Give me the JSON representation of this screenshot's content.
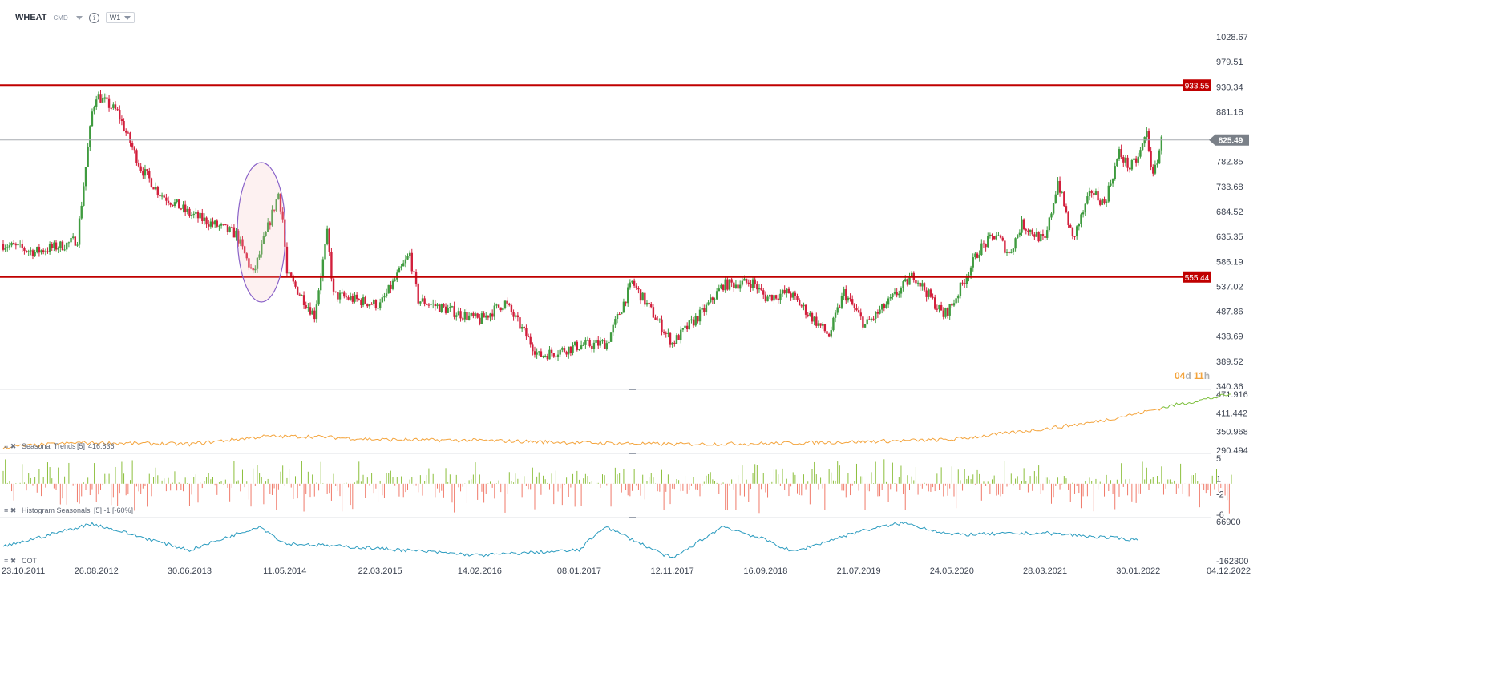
{
  "header": {
    "symbol": "WHEAT",
    "market": "CMD",
    "timeframe": "W1"
  },
  "colors": {
    "up": "#3f9b3f",
    "down": "#d21f3c",
    "level": "#c00000",
    "price_line": "#a7abb0",
    "price_badge": "#7a8088",
    "seasonal_past": "#f4a43c",
    "seasonal_future": "#7cbf3c",
    "hist_pos": "#8cbf3c",
    "hist_neg": "#f07a6a",
    "cot": "#2a9bbf",
    "ellipse": "#8a63c9",
    "countdown": "#f4a43c"
  },
  "chart_data": [
    {
      "type": "candlestick",
      "title": "WHEAT",
      "y_ticks": [
        "1028.67",
        "979.51",
        "930.34",
        "881.18",
        "782.85",
        "733.68",
        "684.52",
        "635.35",
        "586.19",
        "537.02",
        "487.86",
        "438.69",
        "389.52",
        "340.36"
      ],
      "ylim": [
        340.36,
        1028.67
      ],
      "x_ticks": [
        "23.10.2011",
        "26.08.2012",
        "30.06.2013",
        "11.05.2014",
        "22.03.2015",
        "14.02.2016",
        "08.01.2017",
        "12.11.2017",
        "16.09.2018",
        "21.07.2019",
        "24.05.2020",
        "28.03.2021",
        "30.01.2022",
        "04.12.2022"
      ],
      "horizontal_levels": [
        {
          "value": 933.55,
          "label": "933.55"
        },
        {
          "value": 555.44,
          "label": "555.44"
        }
      ],
      "current_price": {
        "value": 825.49,
        "label": "825.49"
      },
      "countdown": {
        "days": "04",
        "d": "d",
        "hours": "11",
        "h": "h"
      },
      "trend_keypoints": [
        {
          "date": "23.10.2011",
          "close": 620
        },
        {
          "date": "05.02.2012",
          "close": 605
        },
        {
          "date": "20.05.2012",
          "close": 620
        },
        {
          "date": "24.06.2012",
          "close": 630
        },
        {
          "date": "12.08.2012",
          "close": 880
        },
        {
          "date": "26.08.2012",
          "close": 915
        },
        {
          "date": "04.11.2012",
          "close": 880
        },
        {
          "date": "20.01.2013",
          "close": 770
        },
        {
          "date": "24.03.2013",
          "close": 720
        },
        {
          "date": "30.06.2013",
          "close": 680
        },
        {
          "date": "01.12.2013",
          "close": 640
        },
        {
          "date": "26.01.2014",
          "close": 560
        },
        {
          "date": "20.04.2014",
          "close": 720
        },
        {
          "date": "04.05.2014",
          "close": 670
        },
        {
          "date": "18.05.2014",
          "close": 560
        },
        {
          "date": "17.08.2014",
          "close": 480
        },
        {
          "date": "28.09.2014",
          "close": 640
        },
        {
          "date": "19.10.2014",
          "close": 520
        },
        {
          "date": "22.03.2015",
          "close": 500
        },
        {
          "date": "28.06.2015",
          "close": 600
        },
        {
          "date": "26.07.2015",
          "close": 510
        },
        {
          "date": "14.02.2016",
          "close": 470
        },
        {
          "date": "08.05.2016",
          "close": 505
        },
        {
          "date": "28.08.2016",
          "close": 400
        },
        {
          "date": "08.01.2017",
          "close": 420
        },
        {
          "date": "09.04.2017",
          "close": 425
        },
        {
          "date": "02.07.2017",
          "close": 545
        },
        {
          "date": "12.11.2017",
          "close": 425
        },
        {
          "date": "25.02.2018",
          "close": 490
        },
        {
          "date": "29.04.2018",
          "close": 540
        },
        {
          "date": "05.08.2018",
          "close": 545
        },
        {
          "date": "16.09.2018",
          "close": 515
        },
        {
          "date": "02.12.2018",
          "close": 525
        },
        {
          "date": "14.04.2019",
          "close": 440
        },
        {
          "date": "02.06.2019",
          "close": 525
        },
        {
          "date": "11.08.2019",
          "close": 460
        },
        {
          "date": "20.10.2019",
          "close": 500
        },
        {
          "date": "19.01.2020",
          "close": 560
        },
        {
          "date": "26.04.2020",
          "close": 480
        },
        {
          "date": "24.05.2020",
          "close": 500
        },
        {
          "date": "23.08.2020",
          "close": 610
        },
        {
          "date": "18.10.2020",
          "close": 640
        },
        {
          "date": "29.11.2020",
          "close": 600
        },
        {
          "date": "10.01.2021",
          "close": 660
        },
        {
          "date": "28.03.2021",
          "close": 625
        },
        {
          "date": "09.05.2021",
          "close": 745
        },
        {
          "date": "27.06.2021",
          "close": 630
        },
        {
          "date": "29.08.2021",
          "close": 725
        },
        {
          "date": "10.10.2021",
          "close": 700
        },
        {
          "date": "28.11.2021",
          "close": 800
        },
        {
          "date": "02.01.2022",
          "close": 770
        },
        {
          "date": "30.01.2022",
          "close": 790
        },
        {
          "date": "27.02.2022",
          "close": 840
        },
        {
          "date": "20.03.2022",
          "close": 750
        },
        {
          "date": "17.04.2022",
          "close": 825
        }
      ]
    },
    {
      "type": "line",
      "title": "Seasonal Trends",
      "params": "[5]",
      "value_label": "416.836",
      "y_ticks": [
        "471.916",
        "411.442",
        "350.968",
        "290.494"
      ],
      "ylim": [
        290.494,
        471.916
      ],
      "keypoints": [
        {
          "date": "23.10.2011",
          "value": 300
        },
        {
          "date": "01.07.2012",
          "value": 315
        },
        {
          "date": "30.06.2013",
          "value": 310
        },
        {
          "date": "02.03.2014",
          "value": 335
        },
        {
          "date": "03.08.2014",
          "value": 335
        },
        {
          "date": "22.03.2015",
          "value": 325
        },
        {
          "date": "14.02.2016",
          "value": 322
        },
        {
          "date": "08.01.2017",
          "value": 315
        },
        {
          "date": "12.11.2017",
          "value": 310
        },
        {
          "date": "16.09.2018",
          "value": 312
        },
        {
          "date": "21.07.2019",
          "value": 318
        },
        {
          "date": "24.05.2020",
          "value": 325
        },
        {
          "date": "28.03.2021",
          "value": 360
        },
        {
          "date": "29.08.2021",
          "value": 380
        },
        {
          "date": "30.01.2022",
          "value": 410
        },
        {
          "date": "22.05.2022",
          "value": 435
        },
        {
          "date": "04.12.2022",
          "value": 472
        }
      ],
      "forecast_from": "17.04.2022"
    },
    {
      "type": "bar",
      "title": "Histogram Seasonals",
      "params": "[5] -1 [-60%]",
      "y_ticks": [
        "5",
        "1",
        "-2",
        "-6"
      ],
      "ylim": [
        -6,
        5
      ],
      "note": "weekly positive/negative seasonal values between -6 and 5"
    },
    {
      "type": "line",
      "title": "COT",
      "y_ticks": [
        "66900",
        "-162300"
      ],
      "ylim": [
        -162300,
        66900
      ],
      "keypoints": [
        {
          "date": "23.10.2011",
          "value": -80000
        },
        {
          "date": "12.08.2012",
          "value": 55000
        },
        {
          "date": "30.06.2013",
          "value": -100000
        },
        {
          "date": "16.02.2014",
          "value": 40000
        },
        {
          "date": "11.05.2014",
          "value": -60000
        },
        {
          "date": "22.03.2015",
          "value": -90000
        },
        {
          "date": "14.02.2016",
          "value": -130000
        },
        {
          "date": "08.01.2017",
          "value": -100000
        },
        {
          "date": "02.04.2017",
          "value": 40000
        },
        {
          "date": "12.11.2017",
          "value": -150000
        },
        {
          "date": "29.04.2018",
          "value": 40000
        },
        {
          "date": "16.09.2018",
          "value": -40000
        },
        {
          "date": "16.12.2018",
          "value": -110000
        },
        {
          "date": "21.07.2019",
          "value": 10000
        },
        {
          "date": "15.12.2019",
          "value": 60000
        },
        {
          "date": "24.05.2020",
          "value": -10000
        },
        {
          "date": "28.03.2021",
          "value": 0
        },
        {
          "date": "30.01.2022",
          "value": -40000
        }
      ]
    }
  ]
}
